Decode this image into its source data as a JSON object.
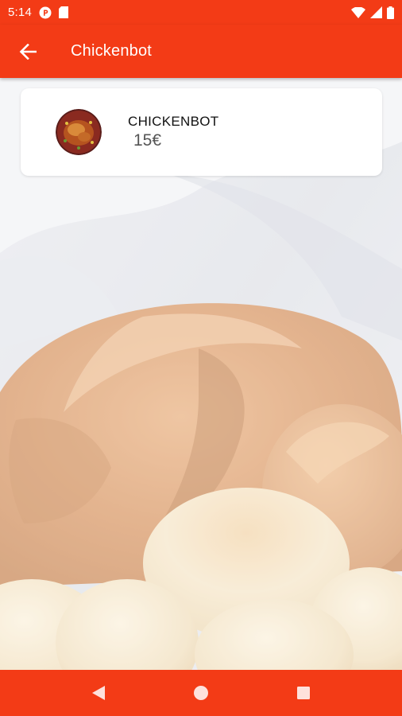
{
  "status_bar": {
    "time": "5:14",
    "icons": [
      "notification-p-icon",
      "sim-card-icon",
      "wifi-icon",
      "signal-icon",
      "battery-icon"
    ]
  },
  "app_bar": {
    "back_icon": "arrow-back-icon",
    "title": "Chickenbot"
  },
  "product": {
    "name": "CHICKENBOT",
    "price": "15€",
    "image_icon": "roast-chicken-thumbnail"
  },
  "nav_bar": {
    "buttons": [
      "back-triangle-icon",
      "home-circle-icon",
      "recents-square-icon"
    ]
  },
  "colors": {
    "accent": "#f33b16",
    "card_background": "#ffffff",
    "price_text": "#555555"
  }
}
